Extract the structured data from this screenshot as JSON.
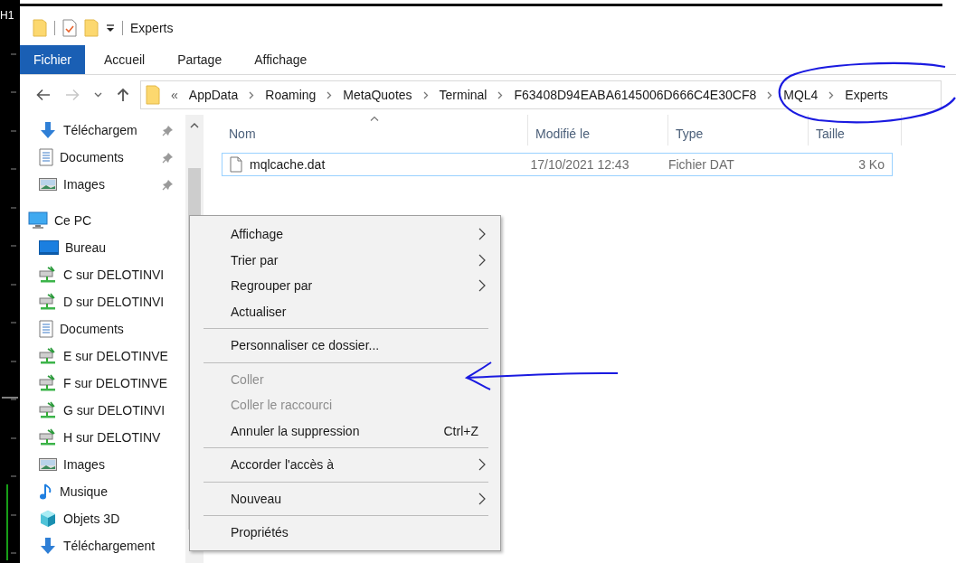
{
  "background": {
    "chart_label": "H1"
  },
  "window": {
    "title": "Experts"
  },
  "ribbon_tabs": [
    {
      "label": "Fichier",
      "selected": true
    },
    {
      "label": "Accueil",
      "selected": false
    },
    {
      "label": "Partage",
      "selected": false
    },
    {
      "label": "Affichage",
      "selected": false
    }
  ],
  "address_bar": {
    "overflow_marker": "«",
    "crumbs": [
      "AppData",
      "Roaming",
      "MetaQuotes",
      "Terminal",
      "F63408D94EABA6145006D666C4E30CF8",
      "MQL4",
      "Experts"
    ]
  },
  "navigation_pane": {
    "quick_access": [
      {
        "label": "Téléchargem",
        "kind": "download",
        "pinned": true
      },
      {
        "label": "Documents",
        "kind": "document",
        "pinned": true
      },
      {
        "label": "Images",
        "kind": "image",
        "pinned": true
      }
    ],
    "this_pc": {
      "label": "Ce PC",
      "kind": "pc",
      "children": [
        {
          "label": "Bureau",
          "kind": "desktop"
        },
        {
          "label": "C sur DELOTINVI",
          "kind": "drive"
        },
        {
          "label": "D sur DELOTINVI",
          "kind": "drive"
        },
        {
          "label": "Documents",
          "kind": "document"
        },
        {
          "label": "E sur DELOTINVE",
          "kind": "drive"
        },
        {
          "label": "F sur DELOTINVE",
          "kind": "drive"
        },
        {
          "label": "G sur DELOTINVI",
          "kind": "drive"
        },
        {
          "label": "H sur DELOTINV",
          "kind": "drive"
        },
        {
          "label": "Images",
          "kind": "image"
        },
        {
          "label": "Musique",
          "kind": "music"
        },
        {
          "label": "Objets 3D",
          "kind": "cube"
        },
        {
          "label": "Téléchargement",
          "kind": "download"
        }
      ]
    }
  },
  "file_list": {
    "columns": [
      {
        "label": "Nom",
        "sorted": true
      },
      {
        "label": "Modifié le",
        "sorted": false
      },
      {
        "label": "Type",
        "sorted": false
      },
      {
        "label": "Taille",
        "sorted": false
      }
    ],
    "rows": [
      {
        "cells": [
          "mqlcache.dat",
          "17/10/2021 12:43",
          "Fichier DAT",
          "3 Ko"
        ],
        "focused": true
      }
    ]
  },
  "context_menu": {
    "items": [
      {
        "kind": "item",
        "label": "Affichage",
        "submenu": true,
        "disabled": false
      },
      {
        "kind": "item",
        "label": "Trier par",
        "submenu": true,
        "disabled": false
      },
      {
        "kind": "item",
        "label": "Regrouper par",
        "submenu": true,
        "disabled": false
      },
      {
        "kind": "item",
        "label": "Actualiser",
        "submenu": false,
        "disabled": false
      },
      {
        "kind": "separator"
      },
      {
        "kind": "item",
        "label": "Personnaliser ce dossier...",
        "submenu": false,
        "disabled": false
      },
      {
        "kind": "separator"
      },
      {
        "kind": "item",
        "label": "Coller",
        "submenu": false,
        "disabled": true
      },
      {
        "kind": "item",
        "label": "Coller le raccourci",
        "submenu": false,
        "disabled": true
      },
      {
        "kind": "item",
        "label": "Annuler la suppression",
        "shortcut": "Ctrl+Z",
        "submenu": false,
        "disabled": false
      },
      {
        "kind": "separator"
      },
      {
        "kind": "item",
        "label": "Accorder l'accès à",
        "submenu": true,
        "disabled": false
      },
      {
        "kind": "separator"
      },
      {
        "kind": "item",
        "label": "Nouveau",
        "submenu": true,
        "disabled": false
      },
      {
        "kind": "separator"
      },
      {
        "kind": "item",
        "label": "Propriétés",
        "submenu": false,
        "disabled": false
      }
    ]
  }
}
